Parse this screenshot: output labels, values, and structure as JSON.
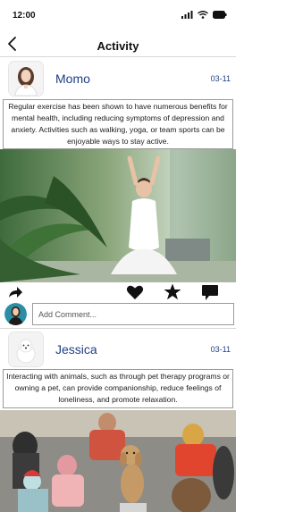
{
  "status": {
    "time": "12:00"
  },
  "header": {
    "title": "Activity"
  },
  "posts": [
    {
      "name": "Momo",
      "date": "03-11",
      "text": "Regular exercise has been shown to have numerous benefits for mental health, including reducing symptoms of depression and anxiety. Activities such as walking, yoga, or team sports can be enjoyable ways to stay active."
    },
    {
      "name": "Jessica",
      "date": "03-11",
      "text": "Interacting with animals, such as through pet therapy programs or owning a pet, can provide companionship, reduce feelings of loneliness, and promote relaxation."
    }
  ],
  "comment": {
    "placeholder": "Add Comment..."
  },
  "icons": {
    "back": "chevron-left-icon",
    "share": "share-arrow-icon",
    "like": "heart-icon",
    "favorite": "star-icon",
    "comment": "comment-bubble-icon"
  },
  "colors": {
    "name_accent": "#1f3e86",
    "icon": "#111111"
  }
}
